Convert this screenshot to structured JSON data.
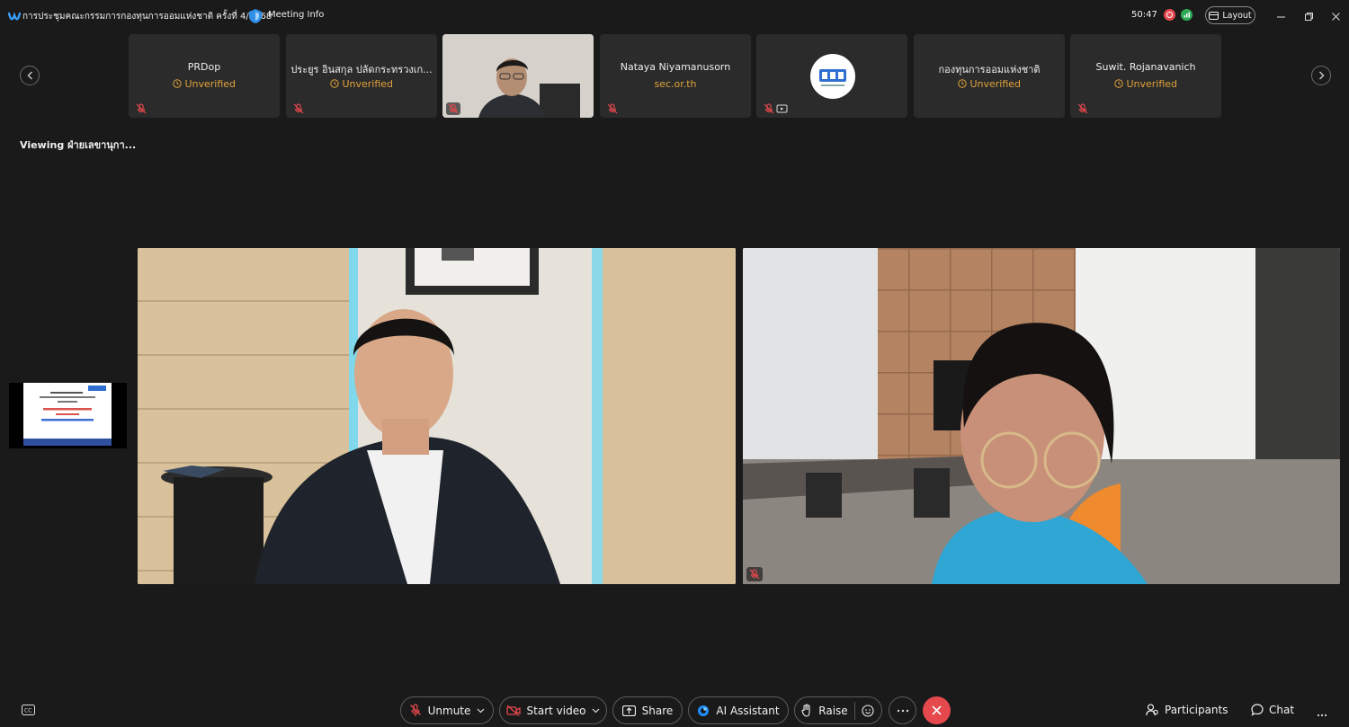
{
  "window": {
    "title": "การประชุมคณะกรรมการกองทุนการออมแห่งชาติ ครั้งที่ 4/2568",
    "meeting_info": "Meeting Info",
    "timer": "50:47",
    "layout_label": "Layout"
  },
  "participants": [
    {
      "name": "PRDop",
      "status": "Unverified",
      "status_kind": "unverified"
    },
    {
      "name": "ประยูร อินสกุล ปลัดกระทรวงเก...",
      "status": "Unverified",
      "status_kind": "unverified"
    },
    {
      "name": "",
      "status": "",
      "status_kind": "video"
    },
    {
      "name": "Nataya Niyamanusorn",
      "status": "sec.or.th",
      "status_kind": "domain"
    },
    {
      "name": "",
      "status": "",
      "status_kind": "logo"
    },
    {
      "name": "กองทุนการออมแห่งชาติ",
      "status": "Unverified",
      "status_kind": "unverified"
    },
    {
      "name": "Suwit. Rojanavanich",
      "status": "Unverified",
      "status_kind": "unverified"
    }
  ],
  "viewing_label": "Viewing ฝ่ายเลขานุกา...",
  "toolbar": {
    "unmute": "Unmute",
    "start_video": "Start video",
    "share": "Share",
    "ai_assistant": "AI Assistant",
    "raise": "Raise",
    "participants": "Participants",
    "chat": "Chat"
  },
  "colors": {
    "background": "#1a1a1a",
    "tile": "#2b2b2b",
    "unverified": "#e0a23a",
    "mute_red": "#e5484d",
    "leave_red": "#e5484d"
  }
}
